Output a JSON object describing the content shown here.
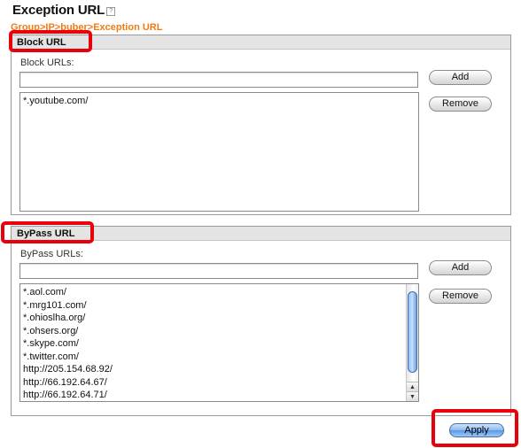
{
  "page": {
    "title": "Exception URL",
    "breadcrumb": "Group>IP>buber>Exception URL"
  },
  "block": {
    "header": "Block URL",
    "field_label": "Block URLs:",
    "input_value": "",
    "add_label": "Add",
    "remove_label": "Remove",
    "items": [
      "*.youtube.com/"
    ]
  },
  "bypass": {
    "header": "ByPass URL",
    "field_label": "ByPass URLs:",
    "input_value": "",
    "add_label": "Add",
    "remove_label": "Remove",
    "items": [
      "*.aol.com/",
      "*.mrg101.com/",
      "*.ohioslha.org/",
      "*.ohsers.org/",
      "*.skype.com/",
      "*.twitter.com/",
      "http://205.154.68.92/",
      "http://66.192.64.67/",
      "http://66.192.64.71/"
    ]
  },
  "footer": {
    "apply_label": "Apply"
  },
  "colors": {
    "accent": "#f07b15",
    "highlight": "#e8000b",
    "button_blue": "#5b98e4"
  }
}
